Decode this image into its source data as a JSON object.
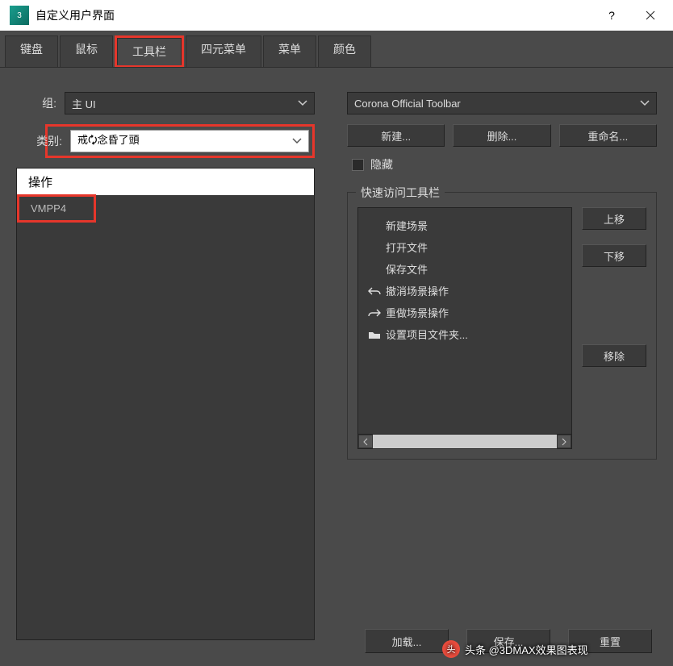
{
  "window": {
    "title": "自定义用户界面"
  },
  "tabs": [
    "键盘",
    "鼠标",
    "工具栏",
    "四元菜单",
    "菜单",
    "颜色"
  ],
  "left": {
    "group_label": "组:",
    "group_value": "主 UI",
    "category_label": "类别:",
    "category_value": "戒🗘念昏了頭",
    "action_header": "操作",
    "action_items": [
      "VMPP4"
    ]
  },
  "right": {
    "toolbar_value": "Corona Official Toolbar",
    "buttons": {
      "new": "新建...",
      "delete": "删除...",
      "rename": "重命名..."
    },
    "hide_label": "隐藏",
    "quick_legend": "快速访问工具栏",
    "quick_items": [
      {
        "icon": "",
        "label": "新建场景"
      },
      {
        "icon": "",
        "label": "打开文件"
      },
      {
        "icon": "",
        "label": "保存文件"
      },
      {
        "icon": "undo",
        "label": "撤消场景操作"
      },
      {
        "icon": "redo",
        "label": "重做场景操作"
      },
      {
        "icon": "folder",
        "label": "设置项目文件夹..."
      }
    ],
    "side": {
      "up": "上移",
      "down": "下移",
      "remove": "移除"
    }
  },
  "bottom": {
    "load": "加载...",
    "save": "保存...",
    "reset": "重置"
  },
  "watermark": "头条 @3DMAX效果图表现"
}
